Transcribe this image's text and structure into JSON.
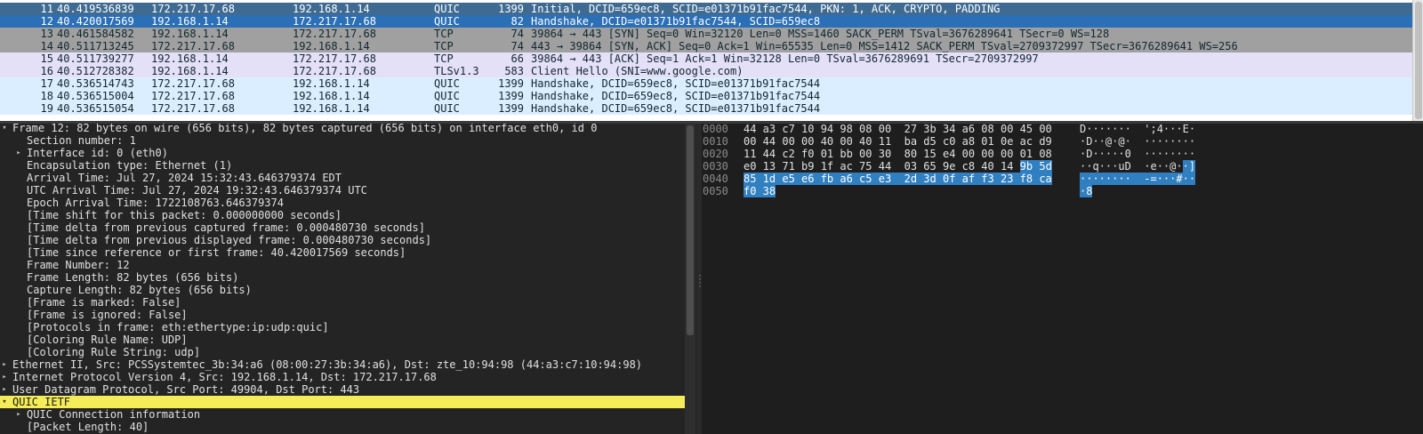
{
  "packet_list": {
    "rows": [
      {
        "no": "11",
        "time": "40.419536839",
        "src": "172.217.17.68",
        "dst": "192.168.1.14",
        "proto": "QUIC",
        "len": "1399",
        "info": "Initial, DCID=659ec8, SCID=e01371b91fac7544, PKN: 1, ACK, CRYPTO, PADDING",
        "style": "sel-dark"
      },
      {
        "no": "12",
        "time": "40.420017569",
        "src": "192.168.1.14",
        "dst": "172.217.17.68",
        "proto": "QUIC",
        "len": "82",
        "info": "Handshake, DCID=e01371b91fac7544, SCID=659ec8",
        "style": "sel-blue"
      },
      {
        "no": "13",
        "time": "40.461584582",
        "src": "192.168.1.14",
        "dst": "172.217.17.68",
        "proto": "TCP",
        "len": "74",
        "info": "39864 → 443 [SYN] Seq=0 Win=32120 Len=0 MSS=1460 SACK_PERM TSval=3676289641 TSecr=0 WS=128",
        "style": "tcp-gray"
      },
      {
        "no": "14",
        "time": "40.511713245",
        "src": "172.217.17.68",
        "dst": "192.168.1.14",
        "proto": "TCP",
        "len": "74",
        "info": "443 → 39864 [SYN, ACK] Seq=0 Ack=1 Win=65535 Len=0 MSS=1412 SACK_PERM TSval=2709372997 TSecr=3676289641 WS=256",
        "style": "tcp-gray"
      },
      {
        "no": "15",
        "time": "40.511739277",
        "src": "192.168.1.14",
        "dst": "172.217.17.68",
        "proto": "TCP",
        "len": "66",
        "info": "39864 → 443 [ACK] Seq=1 Ack=1 Win=32128 Len=0 TSval=3676289691 TSecr=2709372997",
        "style": "tcp-lav"
      },
      {
        "no": "16",
        "time": "40.512728382",
        "src": "192.168.1.14",
        "dst": "172.217.17.68",
        "proto": "TLSv1.3",
        "len": "583",
        "info": "Client Hello (SNI=www.google.com)",
        "style": "tcp-lav"
      },
      {
        "no": "17",
        "time": "40.536514743",
        "src": "172.217.17.68",
        "dst": "192.168.1.14",
        "proto": "QUIC",
        "len": "1399",
        "info": "Handshake, DCID=659ec8, SCID=e01371b91fac7544",
        "style": "quic"
      },
      {
        "no": "18",
        "time": "40.536515004",
        "src": "172.217.17.68",
        "dst": "192.168.1.14",
        "proto": "QUIC",
        "len": "1399",
        "info": "Handshake, DCID=659ec8, SCID=e01371b91fac7544",
        "style": "quic"
      },
      {
        "no": "19",
        "time": "40.536515054",
        "src": "172.217.17.68",
        "dst": "192.168.1.14",
        "proto": "QUIC",
        "len": "1399",
        "info": "Handshake, DCID=659ec8, SCID=e01371b91fac7544",
        "style": "quic"
      }
    ]
  },
  "details": {
    "lines": [
      {
        "indent": 0,
        "arrow": "expanded",
        "text": "Frame 12: 82 bytes on wire (656 bits), 82 bytes captured (656 bits) on interface eth0, id 0"
      },
      {
        "indent": 1,
        "arrow": "none",
        "text": "Section number: 1"
      },
      {
        "indent": 1,
        "arrow": "collapsed",
        "text": "Interface id: 0 (eth0)"
      },
      {
        "indent": 1,
        "arrow": "none",
        "text": "Encapsulation type: Ethernet (1)"
      },
      {
        "indent": 1,
        "arrow": "none",
        "text": "Arrival Time: Jul 27, 2024 15:32:43.646379374 EDT"
      },
      {
        "indent": 1,
        "arrow": "none",
        "text": "UTC Arrival Time: Jul 27, 2024 19:32:43.646379374 UTC"
      },
      {
        "indent": 1,
        "arrow": "none",
        "text": "Epoch Arrival Time: 1722108763.646379374"
      },
      {
        "indent": 1,
        "arrow": "none",
        "text": "[Time shift for this packet: 0.000000000 seconds]"
      },
      {
        "indent": 1,
        "arrow": "none",
        "text": "[Time delta from previous captured frame: 0.000480730 seconds]"
      },
      {
        "indent": 1,
        "arrow": "none",
        "text": "[Time delta from previous displayed frame: 0.000480730 seconds]"
      },
      {
        "indent": 1,
        "arrow": "none",
        "text": "[Time since reference or first frame: 40.420017569 seconds]"
      },
      {
        "indent": 1,
        "arrow": "none",
        "text": "Frame Number: 12"
      },
      {
        "indent": 1,
        "arrow": "none",
        "text": "Frame Length: 82 bytes (656 bits)"
      },
      {
        "indent": 1,
        "arrow": "none",
        "text": "Capture Length: 82 bytes (656 bits)"
      },
      {
        "indent": 1,
        "arrow": "none",
        "text": "[Frame is marked: False]"
      },
      {
        "indent": 1,
        "arrow": "none",
        "text": "[Frame is ignored: False]"
      },
      {
        "indent": 1,
        "arrow": "none",
        "text": "[Protocols in frame: eth:ethertype:ip:udp:quic]"
      },
      {
        "indent": 1,
        "arrow": "none",
        "text": "[Coloring Rule Name: UDP]"
      },
      {
        "indent": 1,
        "arrow": "none",
        "text": "[Coloring Rule String: udp]"
      },
      {
        "indent": 0,
        "arrow": "collapsed",
        "text": "Ethernet II, Src: PCSSystemtec_3b:34:a6 (08:00:27:3b:34:a6), Dst: zte_10:94:98 (44:a3:c7:10:94:98)"
      },
      {
        "indent": 0,
        "arrow": "collapsed",
        "text": "Internet Protocol Version 4, Src: 192.168.1.14, Dst: 172.217.17.68"
      },
      {
        "indent": 0,
        "arrow": "collapsed",
        "text": "User Datagram Protocol, Src Port: 49904, Dst Port: 443"
      },
      {
        "indent": 0,
        "arrow": "expanded",
        "text": "QUIC IETF",
        "highlight": true
      },
      {
        "indent": 1,
        "arrow": "collapsed",
        "text": "QUIC Connection information"
      },
      {
        "indent": 1,
        "arrow": "none",
        "text": "[Packet Length: 40]"
      }
    ]
  },
  "bytes": {
    "lines": [
      {
        "offset": "0000",
        "hex": [
          {
            "t": "44 a3 c7 10 94 98 08 00  27 3b 34 a6 08 00 45 00",
            "sel": false
          }
        ],
        "ascii": [
          {
            "t": "D·······  ';4···E·",
            "sel": false
          }
        ]
      },
      {
        "offset": "0010",
        "hex": [
          {
            "t": "00 44 00 00 40 00 40 11  ba d5 c0 a8 01 0e ac d9",
            "sel": false
          }
        ],
        "ascii": [
          {
            "t": "·D··@·@·  ········",
            "sel": false
          }
        ]
      },
      {
        "offset": "0020",
        "hex": [
          {
            "t": "11 44 c2 f0 01 bb 00 30  80 15 e4 00 00 00 01 08",
            "sel": false
          }
        ],
        "ascii": [
          {
            "t": "·D·····0  ········",
            "sel": false
          }
        ]
      },
      {
        "offset": "0030",
        "hex": [
          {
            "t": "e0 13 71 b9 1f ac 75 44  03 65 9e c8 40 14 ",
            "sel": false
          },
          {
            "t": "9b 5d",
            "sel": true
          }
        ],
        "ascii": [
          {
            "t": "··q···uD  ·e··@·",
            "sel": false
          },
          {
            "t": "·]",
            "sel": true
          }
        ]
      },
      {
        "offset": "0040",
        "hex": [
          {
            "t": "85 1d e5 e6 fb a6 c5 e3  2d 3d 0f af f3 23 f8 ca",
            "sel": true
          }
        ],
        "ascii": [
          {
            "t": "········  -=···#··",
            "sel": true
          }
        ]
      },
      {
        "offset": "0050",
        "hex": [
          {
            "t": "f0 38",
            "sel": true
          }
        ],
        "ascii": [
          {
            "t": "·8",
            "sel": true
          }
        ]
      }
    ]
  }
}
